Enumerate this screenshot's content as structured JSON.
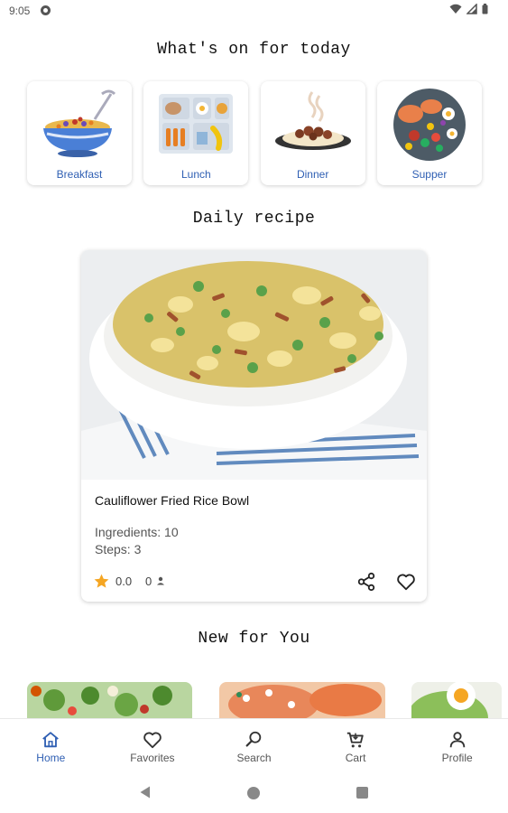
{
  "status_bar": {
    "time": "9:05"
  },
  "sections": {
    "today_title": "What's on for today",
    "daily_title": "Daily recipe",
    "new_title": "New for You"
  },
  "categories": [
    {
      "label": "Breakfast",
      "icon": "cereal-bowl-icon"
    },
    {
      "label": "Lunch",
      "icon": "lunch-tray-icon"
    },
    {
      "label": "Dinner",
      "icon": "dinner-plate-icon"
    },
    {
      "label": "Supper",
      "icon": "supper-platter-icon"
    }
  ],
  "daily_recipe": {
    "name": "Cauliflower Fried Rice Bowl",
    "ingredients": "Ingredients: 10",
    "steps": "Steps: 3",
    "rating": "0.0",
    "reviews": "0"
  },
  "bottom_nav": [
    {
      "label": "Home",
      "icon": "home-icon",
      "active": true
    },
    {
      "label": "Favorites",
      "icon": "heart-icon",
      "active": false
    },
    {
      "label": "Search",
      "icon": "search-icon",
      "active": false
    },
    {
      "label": "Cart",
      "icon": "cart-icon",
      "active": false
    },
    {
      "label": "Profile",
      "icon": "person-icon",
      "active": false
    }
  ],
  "colors": {
    "accent": "#2f5fb3",
    "star": "#f5a623"
  }
}
